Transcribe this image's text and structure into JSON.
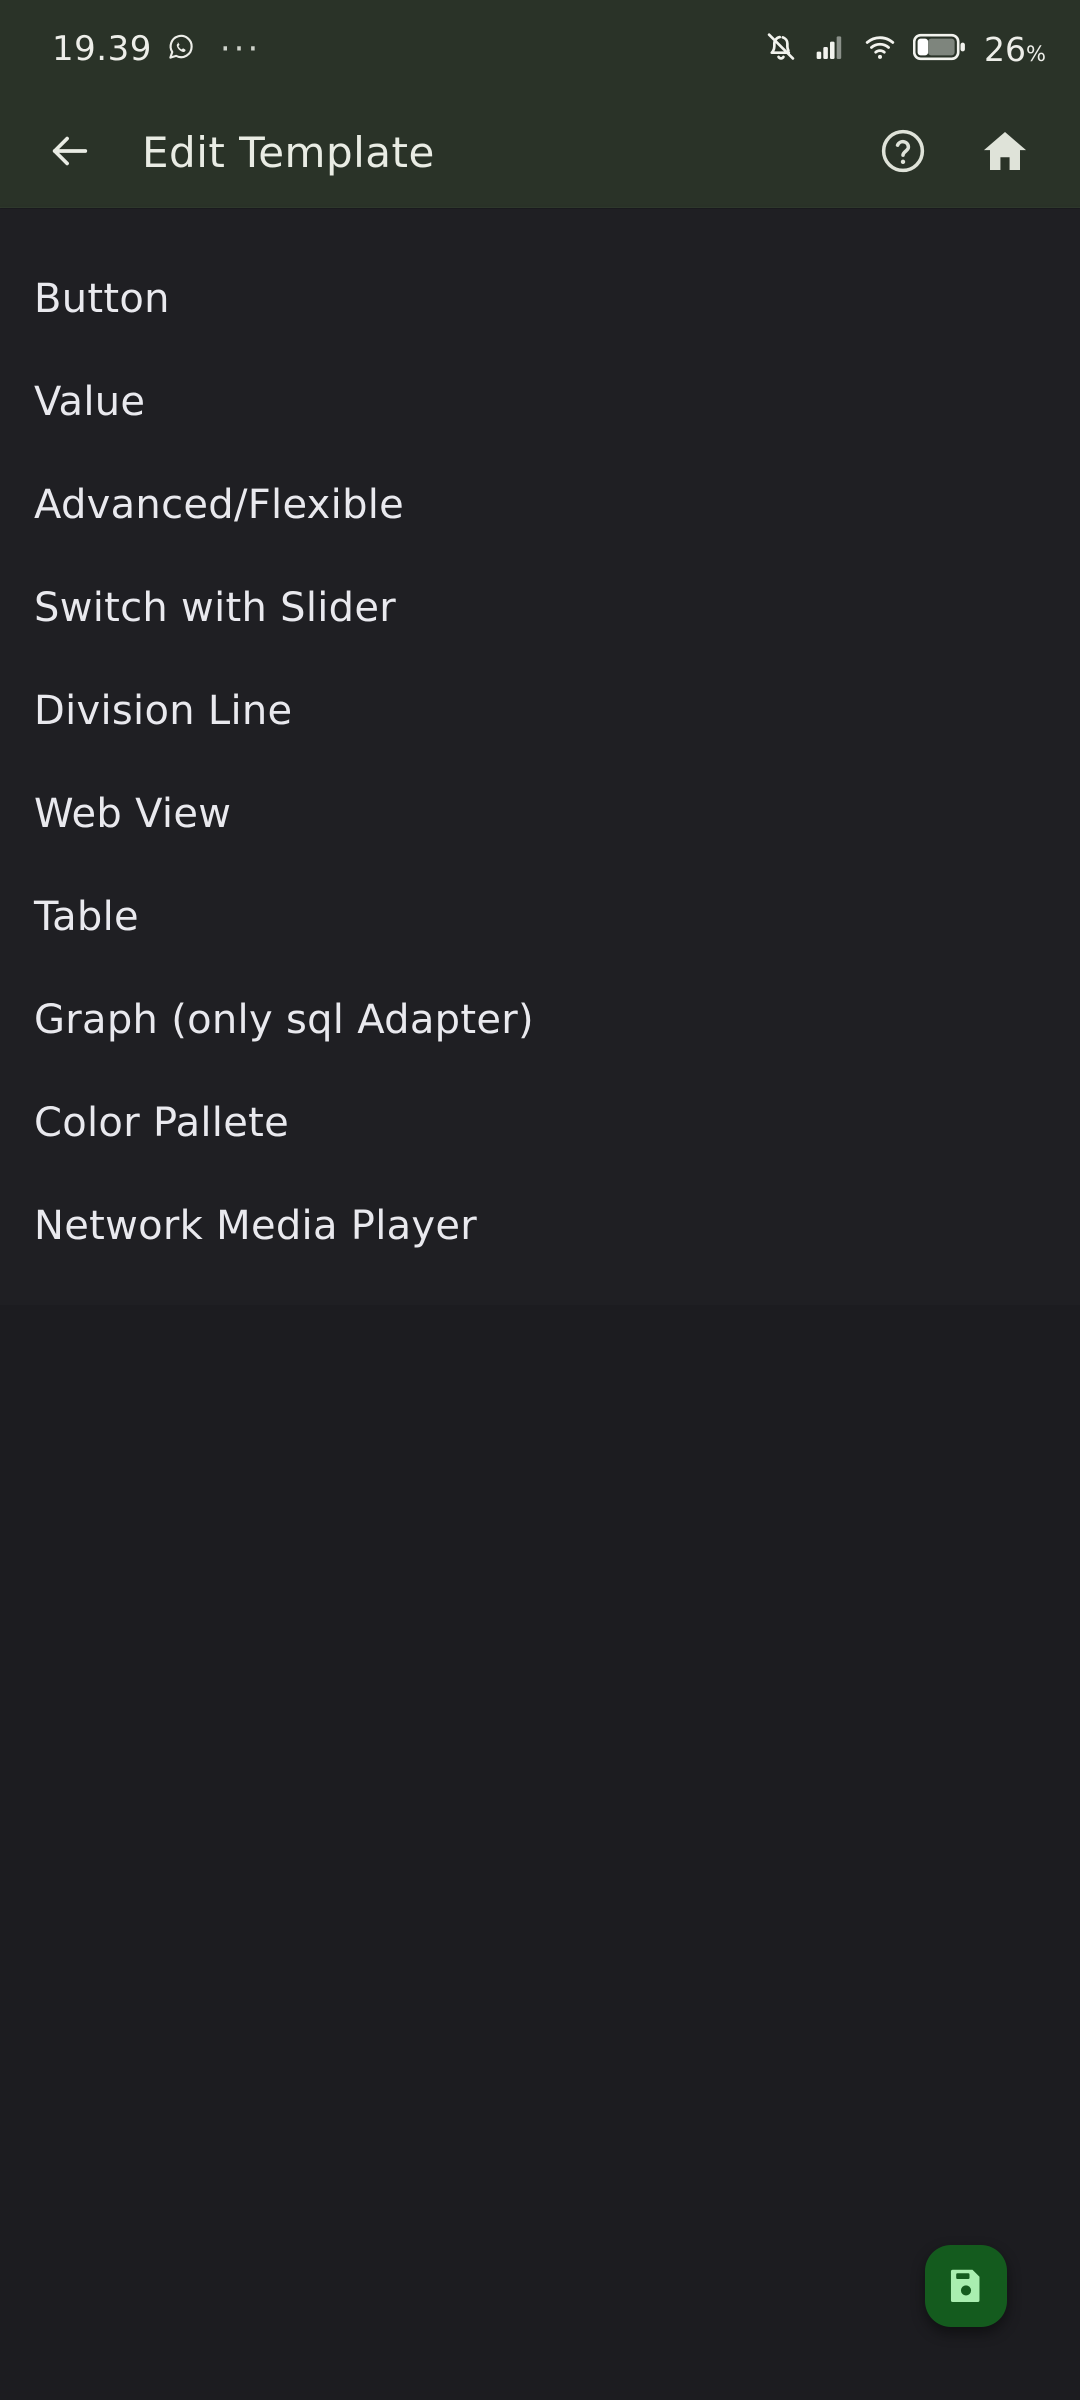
{
  "status_bar": {
    "time": "19.39",
    "messaging_icon": "whatsapp-icon",
    "overflow_dots": "···",
    "notifications_muted_icon": "bell-muted-icon",
    "signal_icon": "cellular-signal-icon",
    "wifi_icon": "wifi-icon",
    "battery_icon": "battery-icon",
    "battery_level": "26",
    "battery_unit": "%",
    "battery_fill_percent": 26
  },
  "app_bar": {
    "back_icon": "arrow-left-icon",
    "title": "Edit Template",
    "help_icon": "help-circle-icon",
    "home_icon": "home-icon"
  },
  "template_list": {
    "items": [
      {
        "label": "Button"
      },
      {
        "label": "Value"
      },
      {
        "label": "Advanced/Flexible"
      },
      {
        "label": "Switch with Slider"
      },
      {
        "label": "Division Line"
      },
      {
        "label": "Web View"
      },
      {
        "label": "Table"
      },
      {
        "label": "Graph (only sql Adapter)"
      },
      {
        "label": "Color Pallete"
      },
      {
        "label": "Network Media Player"
      }
    ]
  },
  "fab": {
    "icon": "save-floppy-icon",
    "action": "save"
  },
  "colors": {
    "app_bar_bg": "#2a3328",
    "page_bg": "#1c1c20",
    "list_panel_bg": "#1f1f23",
    "primary_text": "#e9e9ee",
    "app_bar_text": "#e9ece4",
    "fab_bg": "#145b1e",
    "fab_icon": "#a9eeb0"
  }
}
